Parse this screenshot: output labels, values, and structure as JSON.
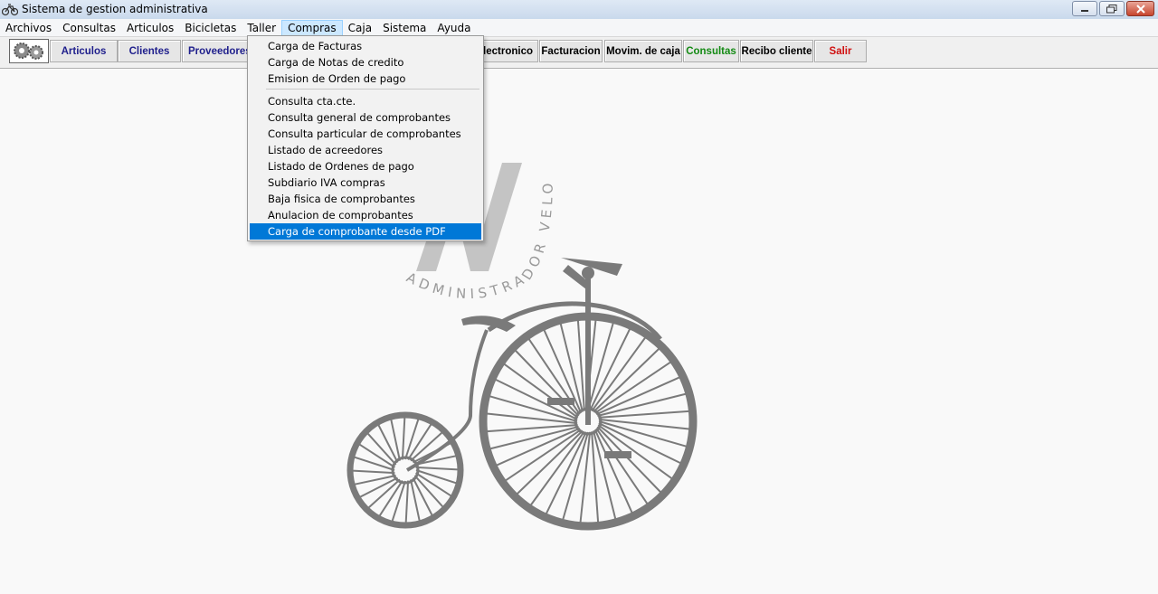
{
  "window": {
    "title": "Sistema de gestion administrativa"
  },
  "menubar": {
    "items": [
      "Archivos",
      "Consultas",
      "Articulos",
      "Bicicletas",
      "Taller",
      "Compras",
      "Caja",
      "Sistema",
      "Ayuda"
    ]
  },
  "toolbar": {
    "buttons": [
      {
        "label": "Articulos",
        "color": "#1f1f8c"
      },
      {
        "label": "Clientes",
        "color": "#1f1f8c"
      },
      {
        "label": "Proveedores",
        "color": "#1f1f8c"
      },
      {
        "label": "Electronico",
        "color": "#000000"
      },
      {
        "label": "Facturacion",
        "color": "#000000"
      },
      {
        "label": "Movim. de caja",
        "color": "#000000"
      },
      {
        "label": "Consultas",
        "color": "#138a13"
      },
      {
        "label": "Recibo cliente",
        "color": "#000000"
      },
      {
        "label": "Salir",
        "color": "#d01010"
      }
    ]
  },
  "dropdown": {
    "items": [
      "Carga de Facturas",
      "Carga de Notas de credito",
      "Emision de Orden de pago",
      "Consulta cta.cte.",
      "Consulta general de comprobantes",
      "Consulta particular de comprobantes",
      "Listado de acreedores",
      "Listado de Ordenes de pago",
      "Subdiario IVA compras",
      "Baja fisica de comprobantes",
      "Anulacion de comprobantes",
      "Carga de comprobante desde PDF"
    ]
  },
  "watermark": {
    "brand_text": "ADMINISTRADOR VELO",
    "monogram": "AV"
  },
  "colors": {
    "highlight": "#0078d7",
    "watermark_gray": "#7a7a7a"
  }
}
